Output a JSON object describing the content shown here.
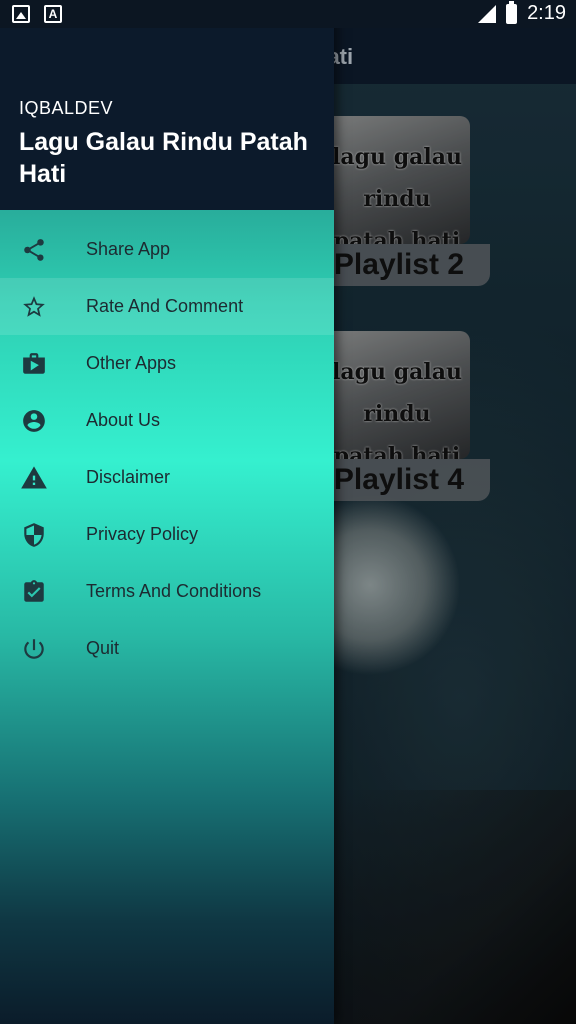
{
  "status_bar": {
    "time": "2:19",
    "left_icons": [
      "gallery-icon",
      "a-notification-icon"
    ],
    "right_icons": [
      "signal-icon",
      "battery-charging-icon"
    ]
  },
  "background_app": {
    "toolbar_title": "n Hati",
    "cards": [
      {
        "image_text": [
          "lagu galau",
          "rindu",
          "patah hati"
        ],
        "label": "Playlist 2"
      },
      {
        "image_text": [
          "lagu galau",
          "rindu",
          "patah hati"
        ],
        "label": "Playlist 4"
      }
    ]
  },
  "drawer": {
    "header": {
      "subtitle": "IQBALDEV",
      "title": "Lagu Galau Rindu Patah Hati"
    },
    "items": [
      {
        "label": "Share App",
        "icon": "share-icon",
        "active": false
      },
      {
        "label": "Rate And Comment",
        "icon": "star-outline-icon",
        "active": true
      },
      {
        "label": "Other Apps",
        "icon": "shop-bag-icon",
        "active": false
      },
      {
        "label": "About Us",
        "icon": "account-circle-icon",
        "active": false
      },
      {
        "label": "Disclaimer",
        "icon": "warning-icon",
        "active": false
      },
      {
        "label": "Privacy Policy",
        "icon": "shield-icon",
        "active": false
      },
      {
        "label": "Terms And Conditions",
        "icon": "clipboard-check-icon",
        "active": false
      },
      {
        "label": "Quit",
        "icon": "power-icon",
        "active": false
      }
    ]
  },
  "colors": {
    "drawer_header": "#0c1a2b",
    "drawer_accent": "#35f0cf",
    "icon_color": "#1d3a40"
  }
}
